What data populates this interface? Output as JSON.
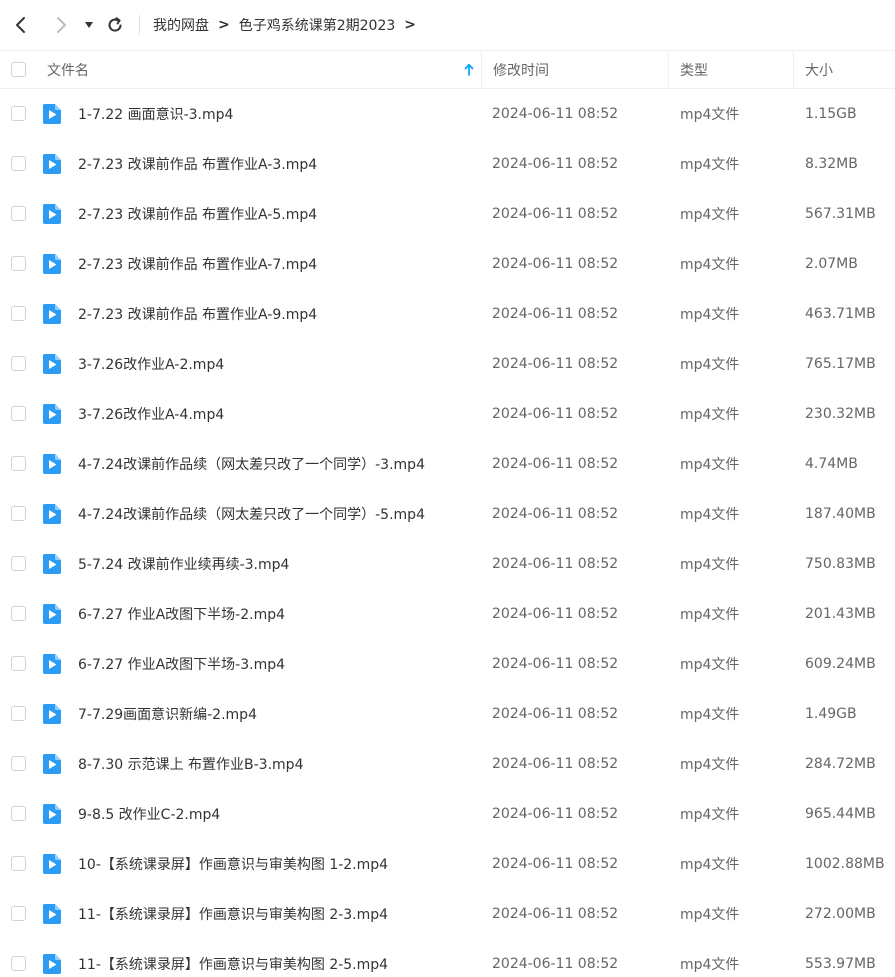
{
  "nav": {
    "breadcrumb": [
      "我的网盘",
      "色子鸡系统课第2期2023"
    ],
    "sep": ">"
  },
  "columns": {
    "name": "文件名",
    "time": "修改时间",
    "type": "类型",
    "size": "大小"
  },
  "files": [
    {
      "name": "1-7.22 画面意识-3.mp4",
      "time": "2024-06-11 08:52",
      "type": "mp4文件",
      "size": "1.15GB"
    },
    {
      "name": "2-7.23 改课前作品 布置作业A-3.mp4",
      "time": "2024-06-11 08:52",
      "type": "mp4文件",
      "size": "8.32MB"
    },
    {
      "name": "2-7.23 改课前作品 布置作业A-5.mp4",
      "time": "2024-06-11 08:52",
      "type": "mp4文件",
      "size": "567.31MB"
    },
    {
      "name": "2-7.23 改课前作品 布置作业A-7.mp4",
      "time": "2024-06-11 08:52",
      "type": "mp4文件",
      "size": "2.07MB"
    },
    {
      "name": "2-7.23 改课前作品 布置作业A-9.mp4",
      "time": "2024-06-11 08:52",
      "type": "mp4文件",
      "size": "463.71MB"
    },
    {
      "name": "3-7.26改作业A-2.mp4",
      "time": "2024-06-11 08:52",
      "type": "mp4文件",
      "size": "765.17MB"
    },
    {
      "name": "3-7.26改作业A-4.mp4",
      "time": "2024-06-11 08:52",
      "type": "mp4文件",
      "size": "230.32MB"
    },
    {
      "name": "4-7.24改课前作品续（网太差只改了一个同学）-3.mp4",
      "time": "2024-06-11 08:52",
      "type": "mp4文件",
      "size": "4.74MB"
    },
    {
      "name": "4-7.24改课前作品续（网太差只改了一个同学）-5.mp4",
      "time": "2024-06-11 08:52",
      "type": "mp4文件",
      "size": "187.40MB"
    },
    {
      "name": "5-7.24 改课前作业续再续-3.mp4",
      "time": "2024-06-11 08:52",
      "type": "mp4文件",
      "size": "750.83MB"
    },
    {
      "name": "6-7.27 作业A改图下半场-2.mp4",
      "time": "2024-06-11 08:52",
      "type": "mp4文件",
      "size": "201.43MB"
    },
    {
      "name": "6-7.27 作业A改图下半场-3.mp4",
      "time": "2024-06-11 08:52",
      "type": "mp4文件",
      "size": "609.24MB"
    },
    {
      "name": "7-7.29画面意识新编-2.mp4",
      "time": "2024-06-11 08:52",
      "type": "mp4文件",
      "size": "1.49GB"
    },
    {
      "name": "8-7.30 示范课上 布置作业B-3.mp4",
      "time": "2024-06-11 08:52",
      "type": "mp4文件",
      "size": "284.72MB"
    },
    {
      "name": "9-8.5 改作业C-2.mp4",
      "time": "2024-06-11 08:52",
      "type": "mp4文件",
      "size": "965.44MB"
    },
    {
      "name": "10-【系统课录屏】作画意识与审美构图 1-2.mp4",
      "time": "2024-06-11 08:52",
      "type": "mp4文件",
      "size": "1002.88MB"
    },
    {
      "name": "11-【系统课录屏】作画意识与审美构图 2-3.mp4",
      "time": "2024-06-11 08:52",
      "type": "mp4文件",
      "size": "272.00MB"
    },
    {
      "name": "11-【系统课录屏】作画意识与审美构图 2-5.mp4",
      "time": "2024-06-11 08:52",
      "type": "mp4文件",
      "size": "553.97MB"
    }
  ],
  "colors": {
    "accent": "#06a7ff",
    "file_icon": "#2b9bf4"
  }
}
